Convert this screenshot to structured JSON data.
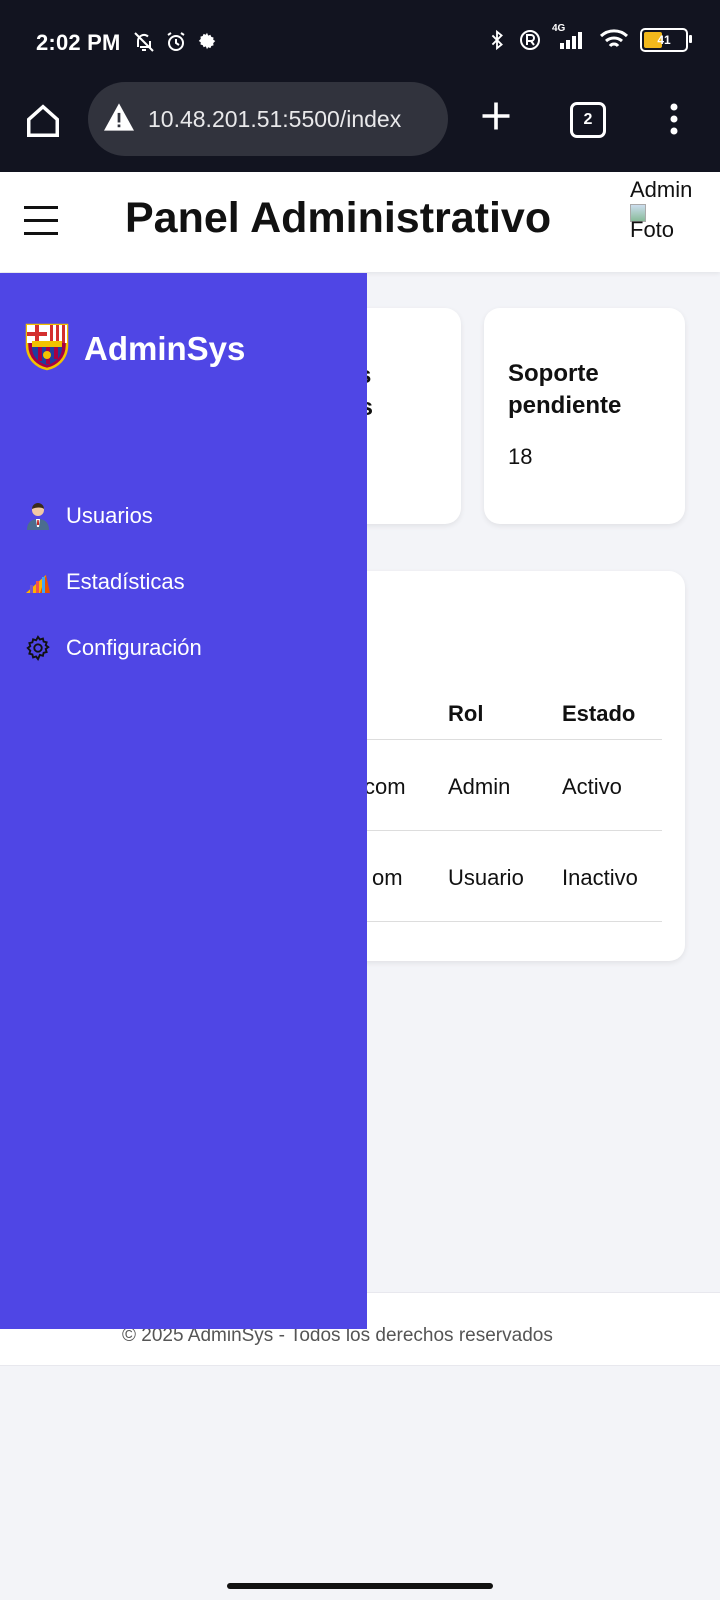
{
  "status_bar": {
    "time": "2:02 PM",
    "network": "4G",
    "battery_level": "41",
    "left_icons": [
      "bell-off-icon",
      "alarm-icon",
      "gear-icon"
    ],
    "right_icons": [
      "bluetooth-icon",
      "registered-icon",
      "signal-icon",
      "wifi-icon",
      "battery-icon"
    ]
  },
  "browser": {
    "url": "10.48.201.51:5500/index",
    "tab_count": "2"
  },
  "header": {
    "title": "Panel Administrativo",
    "user_label": "Admin",
    "photo_alt": "Foto"
  },
  "sidebar": {
    "brand": "AdminSys",
    "items": [
      {
        "label": "Usuarios",
        "icon": "user-icon"
      },
      {
        "label": "Estadísticas",
        "icon": "chart-icon"
      },
      {
        "label": "Configuración",
        "icon": "gear-icon"
      }
    ]
  },
  "cards": [
    {
      "title_partial_1": "s",
      "title_partial_2": "os"
    },
    {
      "title": "Soporte pendiente",
      "value": "18"
    }
  ],
  "table": {
    "headers": [
      "Rol",
      "Estado"
    ],
    "rows": [
      {
        "email_partial": "com",
        "rol": "Admin",
        "estado": "Activo"
      },
      {
        "email_partial": "om",
        "rol": "Usuario",
        "estado": "Inactivo"
      }
    ]
  },
  "footer": {
    "text": "© 2025 AdminSys - Todos los derechos reservados"
  },
  "colors": {
    "sidebar_bg": "#4f46e5",
    "system_bar_bg": "#121420",
    "page_bg": "#f3f4f8"
  }
}
